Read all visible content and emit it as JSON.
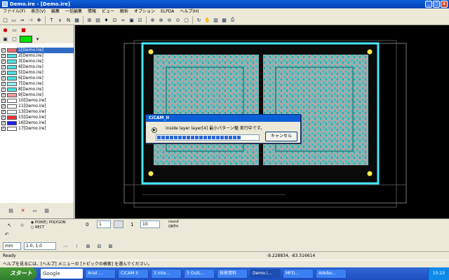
{
  "window": {
    "title": "Demo.ire - [Demo.ire]",
    "min": "_",
    "max": "□",
    "close": "x"
  },
  "menu": [
    "ファイル(F)",
    "表示(V)",
    "編集",
    "一括編集",
    "情報",
    "ビュー",
    "解析",
    "オプション",
    "ELPDA",
    "ヘルプ(H)"
  ],
  "layers": [
    {
      "label": "1[Demo.ire]",
      "color": "#ff6a6a"
    },
    {
      "label": "2[Demo.ire]",
      "color": "#4ee0e0"
    },
    {
      "label": "3[Demo.ire]",
      "color": "#4ee0e0"
    },
    {
      "label": "4[Demo.ire]",
      "color": "#4ee0e0"
    },
    {
      "label": "5[Demo.ire]",
      "color": "#4ee0e0"
    },
    {
      "label": "6[Demo.ire]",
      "color": "#4ee0e0"
    },
    {
      "label": "7[Demo.ire]",
      "color": "#8ff0f0"
    },
    {
      "label": "8[Demo.ire]",
      "color": "#4ee0e0"
    },
    {
      "label": "9[Demo.ire]",
      "color": "#ff9c9c"
    },
    {
      "label": "10[Demo.ire]",
      "color": "#ffffff"
    },
    {
      "label": "11[Demo.ire]",
      "color": "#ffffff"
    },
    {
      "label": "13[Demo.ire]",
      "color": "#ffffff"
    },
    {
      "label": "15[Demo.ire]",
      "color": "#ff3030"
    },
    {
      "label": "16[Demo.ire]",
      "color": "#2020ff"
    },
    {
      "label": "17[Demo.ire]",
      "color": "#ffffff"
    }
  ],
  "dialog": {
    "title": "CiCAM_II",
    "message": "inside layer layer[4] 最小パターン幅 実行中です。",
    "cancel": "キャンセル",
    "progress": 0.83
  },
  "bottom": {
    "point": "POINT",
    "polygon": "POLYGON",
    "rect": "RECT",
    "w_label": "0",
    "w_value": "1",
    "h_label": "1",
    "h_value": "10",
    "round": "round",
    "ortho": "ORTH",
    "unit": "mm",
    "grid": "1.0, 1.0"
  },
  "status": {
    "left": "Ready",
    "coord": "-9.228834, -83.516614",
    "hint": "ヘルプを見るには、[ヘルプ] メニューの [トピックの検索] を選んでください。"
  },
  "taskbar": {
    "start": "スタート",
    "google": "Google",
    "tasks": [
      "Ariel ...",
      "CiCAM II",
      "3 Inte...",
      "3 OutL...",
      "技術資料",
      "Demo.i...",
      "MFD...",
      "Adobe..."
    ],
    "clock": "10:23"
  },
  "chart_data": null
}
